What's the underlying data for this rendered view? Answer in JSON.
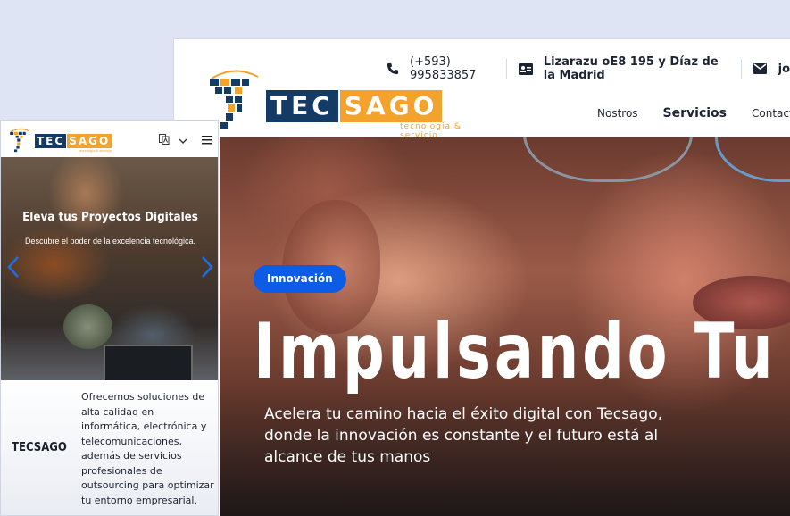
{
  "desktop": {
    "logo": {
      "tec": "TEC",
      "sago": "SAGO",
      "tagline": "tecnología & servicio"
    },
    "topbar": {
      "phone": "(+593) 995833857",
      "address": "Lizarazu oE8 195 y Díaz de la Madrid",
      "email": "jo"
    },
    "nav": {
      "items": [
        "Nostros",
        "Servicios",
        "Contactos"
      ]
    },
    "hero": {
      "badge": "Innovación",
      "title": "Impulsando Tu Futuro",
      "subtitle": "Acelera tu camino hacia el éxito digital con Tecsago, donde la innovación es constante y el futuro está al alcance de tus manos"
    }
  },
  "mobile": {
    "logo": {
      "tec": "TEC",
      "sago": "SAGO",
      "tagline": "tecnología & servicio"
    },
    "slide": {
      "title": "Eleva tus Proyectos Digitales",
      "subtitle": "Descubre el poder de la excelencia tecnológica."
    },
    "info": {
      "brand": "TECSAGO",
      "description": "Ofrecemos soluciones de alta calidad en informática, electrónica y telecomunicaciones, además de servicios profesionales de outsourcing para optimizar tu entorno empresarial."
    }
  },
  "colors": {
    "navy": "#143b66",
    "orange": "#f3a22b",
    "accent_blue": "#0c5ce6"
  },
  "icons": [
    "phone-icon",
    "id-card-icon",
    "mail-icon",
    "translate-icon",
    "chevron-down-icon",
    "hamburger-icon",
    "chevron-left-icon",
    "chevron-right-icon"
  ]
}
